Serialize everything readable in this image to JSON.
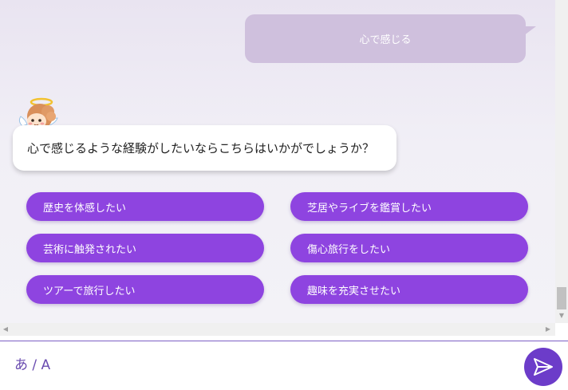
{
  "user_message": "心で感じる",
  "bot_message": "心で感じるような経験がしたいならこちらはいかがでしょうか？",
  "options": [
    {
      "label": "歴史を体感したい"
    },
    {
      "label": "芝居やライブを鑑賞したい"
    },
    {
      "label": "芸術に触発されたい"
    },
    {
      "label": "傷心旅行をしたい"
    },
    {
      "label": "ツアーで旅行したい"
    },
    {
      "label": "趣味を充実させたい"
    }
  ],
  "input": {
    "placeholder": "あ / A",
    "value": ""
  },
  "icons": {
    "avatar": "angel-mascot-icon",
    "send": "send-arrow-icon"
  },
  "colors": {
    "option_button": "#8e44e0",
    "user_bubble": "#cfc0dd",
    "send_button": "#6c3cc9"
  }
}
